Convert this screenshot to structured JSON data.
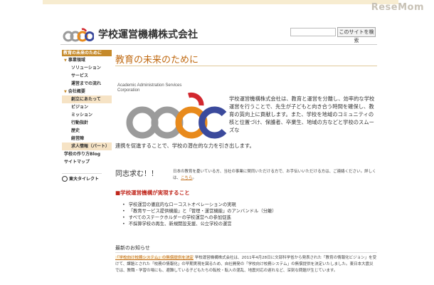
{
  "watermark": "ReseMom",
  "header": {
    "company_name": "学校運営機構株式会社",
    "search_button": "このサイトを検索"
  },
  "sidebar": {
    "head": "教育の未来のために",
    "items": [
      {
        "label": "事業領域",
        "level": 1
      },
      {
        "label": "ソリューション",
        "level": 2
      },
      {
        "label": "サービス",
        "level": 2
      },
      {
        "label": "運営までの流れ",
        "level": 2
      },
      {
        "label": "会社概要",
        "level": 1
      },
      {
        "label": "創立にあたって",
        "level": 2
      },
      {
        "label": "ビジョン",
        "level": 2
      },
      {
        "label": "ミッション",
        "level": 2
      },
      {
        "label": "行動指針",
        "level": 2
      },
      {
        "label": "歴史",
        "level": 2
      },
      {
        "label": "経営陣",
        "level": 2
      },
      {
        "label": "求人情報（パート）",
        "level": 2
      },
      {
        "label": "学校の作り方Blog",
        "level": 1
      },
      {
        "label": "サイトマップ",
        "level": 1
      }
    ],
    "banner": "東大タイレクト"
  },
  "main": {
    "heading": "教育の未来のために",
    "logo_caption": "Academic Administration Services Corporation",
    "intro": "学校運営機構株式会社は、教育と運営を分離し、効率的な学校運営を行うことで、先生が子どもと向き合う時間を確保し、教育の質向上に貢献します。また、学校を地域のコミュニティの核と位置づけ、保護者、卒業生、地域の方などと学校のスムーズな",
    "intro_cont": "連携を促進することで、学校の潜在的な力を引き出します。",
    "recruit_title": "同志求む！！",
    "recruit_text": "日本の教育を憂いている方、当社の事業に賛同いただける方で、お手伝いいただける方は、ご連絡ください。詳しくは、",
    "recruit_link": "こちら",
    "recruit_tail": "。",
    "section_title": "■学校運営機構が実現すること",
    "bullets": [
      "学校運営の徹底的なローコストオペレーションの実現",
      "「教育サービス提供機能」と「管理・運営機能」のアンバンドル（分離）",
      "すべてのステークホルダーの学校運営への参加促進",
      "不採算学校の再生、新規開設支援、公立学校の運営"
    ],
    "news_title": "最新のお知らせ",
    "news_link": "「学校向け校務システム」の無償提供を決定",
    "news_body": " 学校運営機構株式会社は、2011年4月28日に文部科学省から発表された「教育の情報化ビジョン」を受けて、課題とされた「校務の情報化」の早期実現を図るため、自社開発の「学校向け校務システム」の無償提供を決定いたしました。東日本大震災では、教職・学習の場にも、避難している子どもたちの転校・転入の混乱、地震対応の遅れなど、深刻な問題が生じています。"
  },
  "colors": {
    "accent": "#c58a2b",
    "heading": "#c06a12",
    "section_red": "#c0261b",
    "logo_gray": "#9b9b9b",
    "logo_blue": "#3b4a9c",
    "logo_orange": "#e88a1c",
    "logo_red": "#d2272e"
  }
}
